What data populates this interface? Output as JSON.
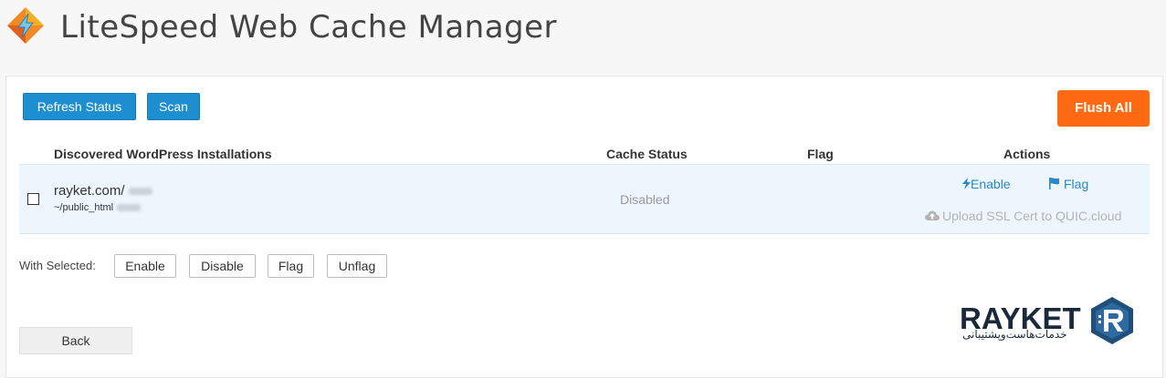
{
  "app": {
    "title": "LiteSpeed Web Cache Manager",
    "logo_icon": "litespeed-logo-icon"
  },
  "toolbar": {
    "refresh_label": "Refresh Status",
    "scan_label": "Scan",
    "flush_all_label": "Flush All"
  },
  "table": {
    "headers": {
      "installations": "Discovered WordPress Installations",
      "cache_status": "Cache Status",
      "flag": "Flag",
      "actions": "Actions"
    },
    "rows": [
      {
        "domain": "rayket.com/",
        "path": "~/public_html",
        "cache_status": "Disabled",
        "enable_label": "Enable",
        "flag_label": "Flag",
        "upload_label": "Upload SSL Cert to QUIC.cloud"
      }
    ]
  },
  "bulk": {
    "label": "With Selected:",
    "enable": "Enable",
    "disable": "Disable",
    "flag": "Flag",
    "unflag": "Unflag"
  },
  "back_label": "Back",
  "watermark": {
    "brand": "RAYKET",
    "tagline": "خدمات‌هاست‌وپشتیبانی"
  },
  "colors": {
    "primary_button": "#1d8fd0",
    "flush_button": "#ff6a13",
    "link": "#2a88c6",
    "row_highlight": "#eef6fd"
  }
}
